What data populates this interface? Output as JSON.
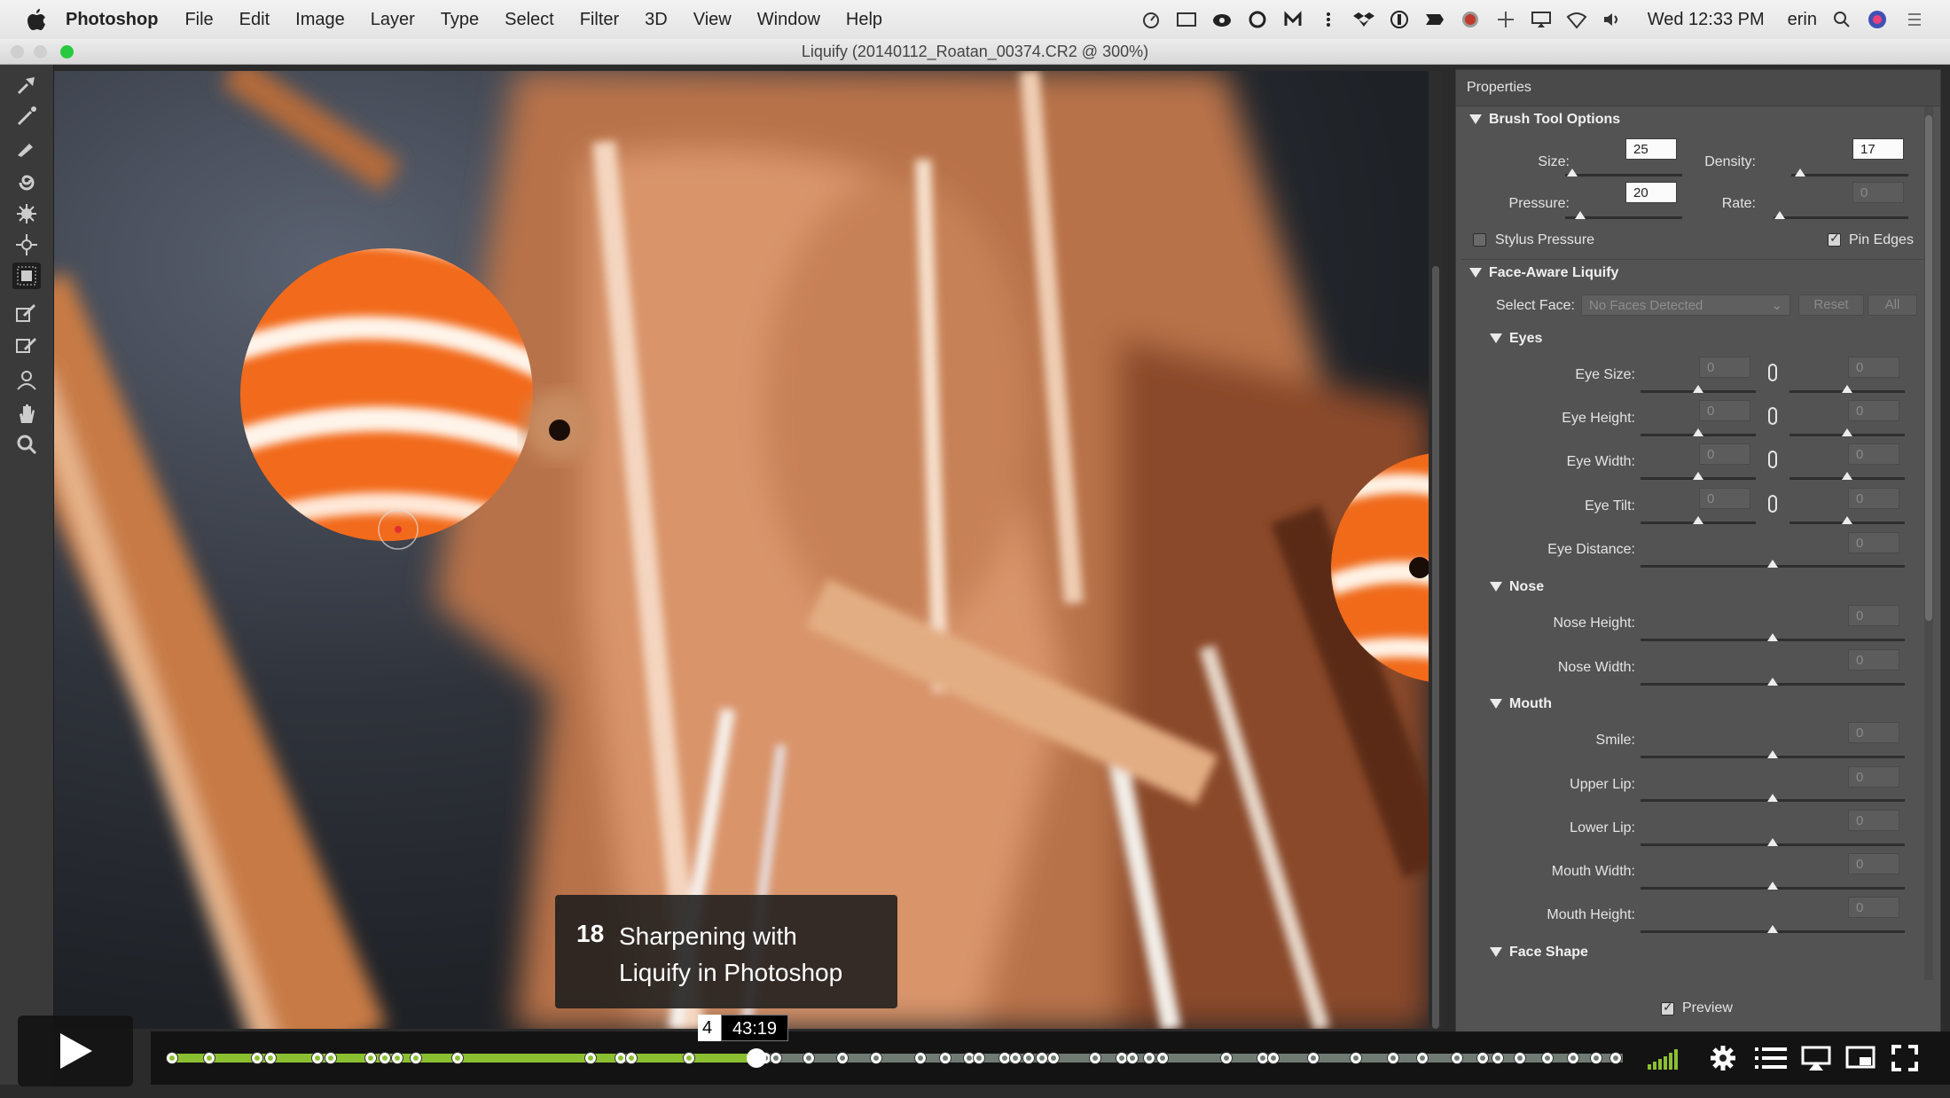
{
  "menubar": {
    "app_name": "Photoshop",
    "items": [
      "File",
      "Edit",
      "Image",
      "Layer",
      "Type",
      "Select",
      "Filter",
      "3D",
      "View",
      "Window",
      "Help"
    ],
    "clock": "Wed 12:33 PM",
    "user": "erin"
  },
  "window": {
    "title": "Liquify (20140112_Roatan_00374.CR2 @ 300%)"
  },
  "tools": [
    "forward-warp",
    "reconstruct",
    "smooth",
    "twirl-clockwise",
    "pucker",
    "bloat",
    "push-left",
    "freeze-mask",
    "thaw-mask",
    "face",
    "hand",
    "zoom"
  ],
  "properties": {
    "title": "Properties",
    "brush": {
      "section": "Brush Tool Options",
      "size_label": "Size:",
      "size_value": "25",
      "density_label": "Density:",
      "density_value": "17",
      "pressure_label": "Pressure:",
      "pressure_value": "20",
      "rate_label": "Rate:",
      "rate_value": "0",
      "stylus_label": "Stylus Pressure",
      "pin_label": "Pin Edges"
    },
    "face": {
      "section": "Face-Aware Liquify",
      "select_face_label": "Select Face:",
      "select_face_value": "No Faces Detected",
      "reset_label": "Reset",
      "all_label": "All"
    },
    "eyes": {
      "section": "Eyes",
      "rows": [
        {
          "label": "Eye Size:",
          "left": "0",
          "right": "0"
        },
        {
          "label": "Eye Height:",
          "left": "0",
          "right": "0"
        },
        {
          "label": "Eye Width:",
          "left": "0",
          "right": "0"
        },
        {
          "label": "Eye Tilt:",
          "left": "0",
          "right": "0"
        }
      ],
      "distance_label": "Eye Distance:",
      "distance_value": "0"
    },
    "nose": {
      "section": "Nose",
      "rows": [
        {
          "label": "Nose Height:",
          "value": "0"
        },
        {
          "label": "Nose Width:",
          "value": "0"
        }
      ]
    },
    "mouth": {
      "section": "Mouth",
      "rows": [
        {
          "label": "Smile:",
          "value": "0"
        },
        {
          "label": "Upper Lip:",
          "value": "0"
        },
        {
          "label": "Lower Lip:",
          "value": "0"
        },
        {
          "label": "Mouth Width:",
          "value": "0"
        },
        {
          "label": "Mouth Height:",
          "value": "0"
        }
      ]
    },
    "face_shape": {
      "section": "Face Shape"
    },
    "preview_label": "Preview"
  },
  "player": {
    "chapter_number": "18",
    "chapter_title_line1": "Sharpening with",
    "chapter_title_line2": "Liquify in Photoshop",
    "time_tooltip": "43:19",
    "time_tooltip_hidden": "4",
    "progress_fraction": 0.404,
    "played_color": "#8bbf32",
    "buffered_color": "#6f7b72"
  },
  "colors": {
    "menubar": "#ececec",
    "panel": "#535353",
    "toolbar": "#3a3a3a"
  }
}
